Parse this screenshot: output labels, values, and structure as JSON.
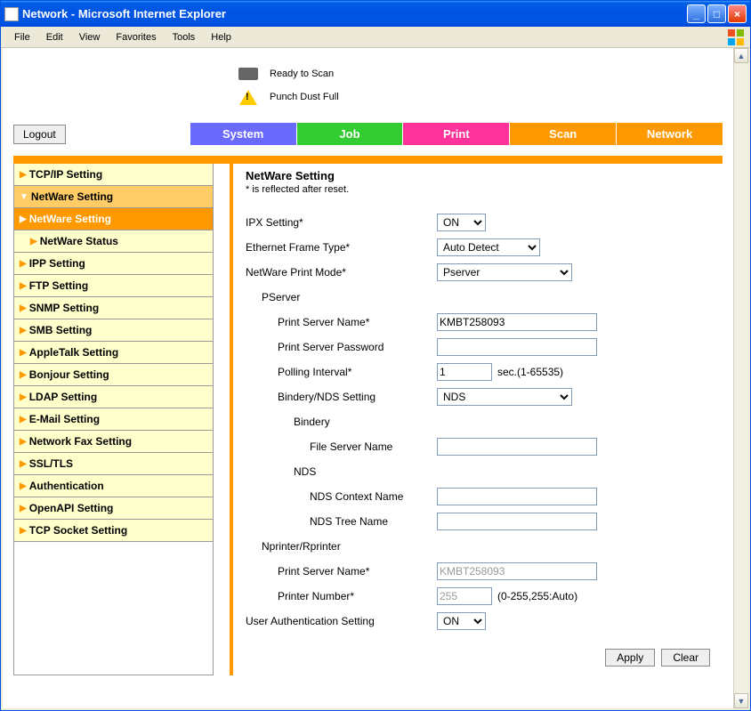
{
  "window": {
    "title": "Network - Microsoft Internet Explorer"
  },
  "menubar": [
    "File",
    "Edit",
    "View",
    "Favorites",
    "Tools",
    "Help"
  ],
  "status": {
    "line1": "Ready to Scan",
    "line2": "Punch Dust Full"
  },
  "logout_label": "Logout",
  "tabs": [
    {
      "label": "System",
      "color": "#6a6aff"
    },
    {
      "label": "Job",
      "color": "#33cc33"
    },
    {
      "label": "Print",
      "color": "#ff3399"
    },
    {
      "label": "Scan",
      "color": "#ff9900"
    },
    {
      "label": "Network",
      "color": "#ff9900"
    }
  ],
  "sidebar": [
    {
      "label": "TCP/IP Setting",
      "level": "1"
    },
    {
      "label": "NetWare Setting",
      "level": "2",
      "arrow": "▼"
    },
    {
      "label": "NetWare Setting",
      "level": "3"
    },
    {
      "label": "NetWare Status",
      "level": "3sub"
    },
    {
      "label": "IPP Setting",
      "level": "1"
    },
    {
      "label": "FTP Setting",
      "level": "1"
    },
    {
      "label": "SNMP Setting",
      "level": "1"
    },
    {
      "label": "SMB Setting",
      "level": "1"
    },
    {
      "label": "AppleTalk Setting",
      "level": "1"
    },
    {
      "label": "Bonjour Setting",
      "level": "1"
    },
    {
      "label": "LDAP Setting",
      "level": "1"
    },
    {
      "label": "E-Mail Setting",
      "level": "1"
    },
    {
      "label": "Network Fax Setting",
      "level": "1"
    },
    {
      "label": "SSL/TLS",
      "level": "1"
    },
    {
      "label": "Authentication",
      "level": "1"
    },
    {
      "label": "OpenAPI Setting",
      "level": "1"
    },
    {
      "label": "TCP Socket Setting",
      "level": "1"
    }
  ],
  "content": {
    "title": "NetWare Setting",
    "note": "* is reflected after reset.",
    "ipx_label": "IPX Setting*",
    "ipx_value": "ON",
    "frame_label": "Ethernet Frame Type*",
    "frame_value": "Auto Detect",
    "mode_label": "NetWare Print Mode*",
    "mode_value": "Pserver",
    "pserver_heading": "PServer",
    "psname_label": "Print Server Name*",
    "psname_value": "KMBT258093",
    "pspw_label": "Print Server Password",
    "pspw_value": "",
    "poll_label": "Polling Interval*",
    "poll_value": "1",
    "poll_suffix": "sec.(1-65535)",
    "bindnds_label": "Bindery/NDS Setting",
    "bindnds_value": "NDS",
    "bindery_heading": "Bindery",
    "fsname_label": "File Server Name",
    "fsname_value": "",
    "nds_heading": "NDS",
    "ndsctx_label": "NDS Context Name",
    "ndsctx_value": "",
    "ndstree_label": "NDS Tree Name",
    "ndstree_value": "",
    "nprinter_heading": "Nprinter/Rprinter",
    "np_psname_label": "Print Server Name*",
    "np_psname_value": "KMBT258093",
    "np_num_label": "Printer Number*",
    "np_num_value": "255",
    "np_num_suffix": "(0-255,255:Auto)",
    "uauth_label": "User Authentication Setting",
    "uauth_value": "ON",
    "apply_label": "Apply",
    "clear_label": "Clear"
  }
}
